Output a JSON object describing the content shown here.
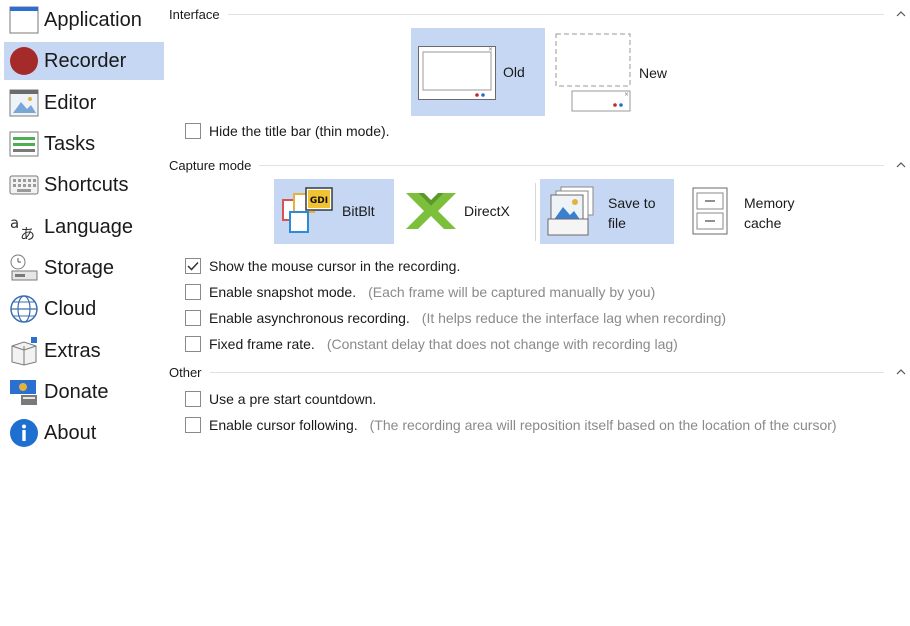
{
  "sidebar": {
    "items": [
      {
        "label": "Application",
        "icon": "application-window-icon"
      },
      {
        "label": "Recorder",
        "icon": "record-dot-icon",
        "selected": true
      },
      {
        "label": "Editor",
        "icon": "image-editor-icon"
      },
      {
        "label": "Tasks",
        "icon": "tasks-list-icon"
      },
      {
        "label": "Shortcuts",
        "icon": "keyboard-icon"
      },
      {
        "label": "Language",
        "icon": "language-translate-icon"
      },
      {
        "label": "Storage",
        "icon": "storage-drive-icon"
      },
      {
        "label": "Cloud",
        "icon": "globe-cloud-icon"
      },
      {
        "label": "Extras",
        "icon": "extras-cube-icon"
      },
      {
        "label": "Donate",
        "icon": "donate-money-icon"
      },
      {
        "label": "About",
        "icon": "info-icon"
      }
    ]
  },
  "interface": {
    "title": "Interface",
    "options": [
      {
        "label": "Old",
        "selected": true
      },
      {
        "label": "New",
        "selected": false
      }
    ],
    "hide_title_bar": {
      "label": "Hide the title bar (thin mode).",
      "checked": false
    }
  },
  "capture_mode": {
    "title": "Capture mode",
    "engines": [
      {
        "label": "BitBlt",
        "selected": true,
        "icon_text": "GDI"
      },
      {
        "label": "DirectX",
        "selected": false
      }
    ],
    "storage": [
      {
        "label": "Save to file",
        "selected": true
      },
      {
        "label": "Memory cache",
        "selected": false
      }
    ],
    "checks": [
      {
        "label": "Show the mouse cursor in the recording.",
        "hint": "",
        "checked": true
      },
      {
        "label": "Enable snapshot mode.",
        "hint": "(Each frame will be captured manually by you)",
        "checked": false
      },
      {
        "label": "Enable asynchronous recording.",
        "hint": "(It helps reduce the interface lag when recording)",
        "checked": false
      },
      {
        "label": "Fixed frame rate.",
        "hint": "(Constant delay that does not change with recording lag)",
        "checked": false
      }
    ]
  },
  "other": {
    "title": "Other",
    "checks": [
      {
        "label": "Use a pre start countdown.",
        "hint": "",
        "checked": false
      },
      {
        "label": "Enable cursor following.",
        "hint": "(The recording area will reposition itself based on the location of the cursor)",
        "checked": false
      }
    ]
  },
  "colors": {
    "selection": "#c5d7f3",
    "record_red": "#a52a2a",
    "accent_blue": "#1e6fd0",
    "directx_green": "#7bbf3a"
  }
}
